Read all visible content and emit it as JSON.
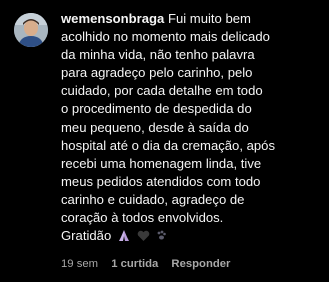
{
  "comment": {
    "username": "wemensonbraga",
    "text_lines": [
      "Fui muito bem",
      "acolhido no momento mais delicado",
      "da minha vida, não tenho palavra",
      "para agradeço pelo carinho, pelo",
      "cuidado, por cada detalhe em todo",
      "o procedimento de despedida do",
      "meu pequeno, desde à saída do",
      "hospital até o dia da cremação, após",
      "recebi uma homenagem linda, tive",
      "meus pedidos atendidos com todo",
      "carinho e cuidado, agradeço de",
      "coração à todos envolvidos.",
      "Gratidão"
    ],
    "emojis": [
      "praying-hands-icon",
      "black-heart-icon",
      "paw-prints-icon"
    ],
    "time_ago": "19 sem",
    "likes": "1 curtida",
    "reply_label": "Responder"
  },
  "colors": {
    "background": "#000000",
    "text": "#f5f5f5",
    "muted": "#a8a8a8"
  }
}
